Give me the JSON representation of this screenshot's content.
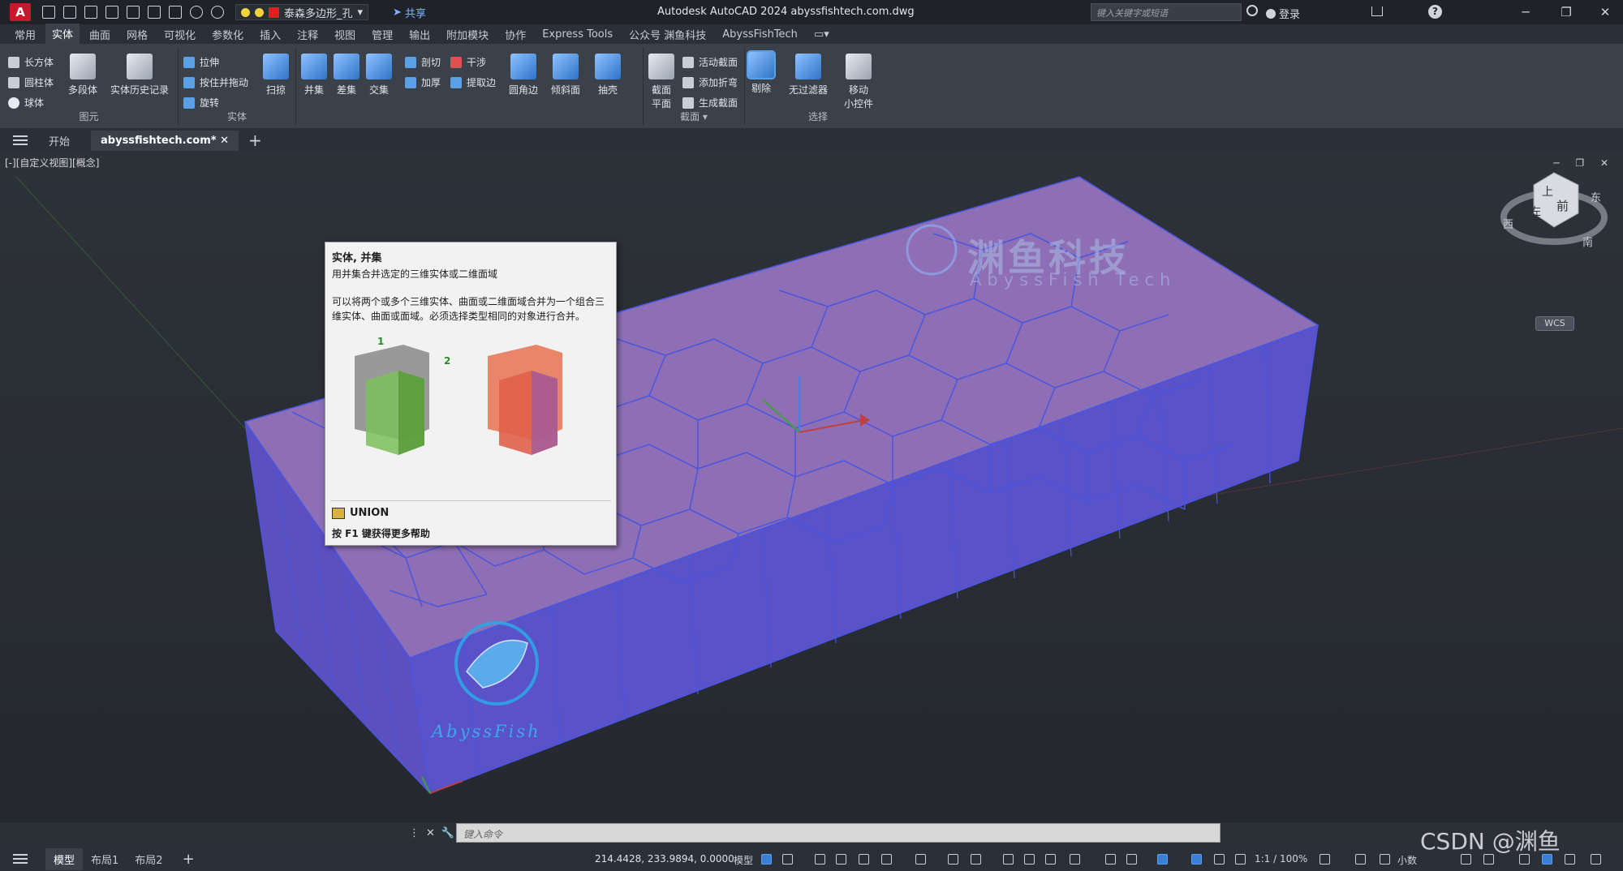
{
  "titlebar": {
    "app_logo": "A",
    "layer_name": "泰森多边形_孔",
    "share_label": "共享",
    "title": "Autodesk AutoCAD 2024   abyssfishtech.com.dwg",
    "search_placeholder": "键入关键字或短语",
    "login_label": "登录",
    "help_label": "?"
  },
  "ribbon_tabs": [
    "常用",
    "实体",
    "曲面",
    "网格",
    "可视化",
    "参数化",
    "插入",
    "注释",
    "视图",
    "管理",
    "输出",
    "附加模块",
    "协作",
    "Express Tools",
    "公众号 渊鱼科技",
    "AbyssFishTech"
  ],
  "ribbon_active_tab": "实体",
  "ribbon": {
    "primitive": {
      "label": "图元",
      "box": "长方体",
      "cylinder": "圆柱体",
      "sphere": "球体",
      "polysolid": "多段体",
      "history": "实体历史记录"
    },
    "solid": {
      "label": "实体",
      "extrude": "拉伸",
      "presspull": "按住并拖动",
      "revolve": "旋转",
      "sweep": "扫掠"
    },
    "boolean": {
      "union": "并集",
      "subtract": "差集",
      "intersect": "交集",
      "slice": "剖切",
      "interfere": "干涉",
      "thicken": "加厚",
      "extract_edges": "提取边",
      "partial": "圆角边",
      "shell": "倾斜面",
      "solid_edit": "抽壳"
    },
    "section": {
      "label": "截面",
      "plane": "截面\n平面",
      "live": "活动截面",
      "jog": "添加折弯",
      "generate": "生成截面"
    },
    "selection": {
      "label": "选择",
      "culling": "剔除",
      "no_filter": "无过滤器",
      "gizmo": "移动\n小控件"
    }
  },
  "doc_tabs": {
    "start": "开始",
    "active": "abyssfishtech.com*"
  },
  "viewport": {
    "label": "[-][自定义视图][概念]",
    "wcs": "WCS"
  },
  "tooltip": {
    "title": "实体, 并集",
    "desc": "用并集合并选定的三维实体或二维面域",
    "body": "可以将两个或多个三维实体、曲面或二维面域合并为一个组合三维实体、曲面或面域。必须选择类型相同的对象进行合并。",
    "fig_label_1": "1",
    "fig_label_2": "2",
    "command": "UNION",
    "help": "按 F1 键获得更多帮助"
  },
  "viewcube": {
    "top": "上",
    "front": "前",
    "west": "西",
    "south": "南",
    "east": "东",
    "left": "左"
  },
  "watermark": {
    "cn": "渊鱼科技",
    "en": "AbyssFish Tech",
    "logo_text": "AbyssFish",
    "csdn": "CSDN @渊鱼"
  },
  "cmdline": {
    "placeholder": "键入命令"
  },
  "statusbar": {
    "tabs": [
      "模型",
      "布局1",
      "布局2"
    ],
    "coords": "214.4428, 233.9894, 0.0000",
    "model": "模型",
    "scale": "1:1 / 100%",
    "units": "小数"
  },
  "colors": {
    "solid_top": "#8e6fb5",
    "solid_side": "#5a52c8",
    "edge": "#4a55e0",
    "accent": "#4a90e2"
  }
}
